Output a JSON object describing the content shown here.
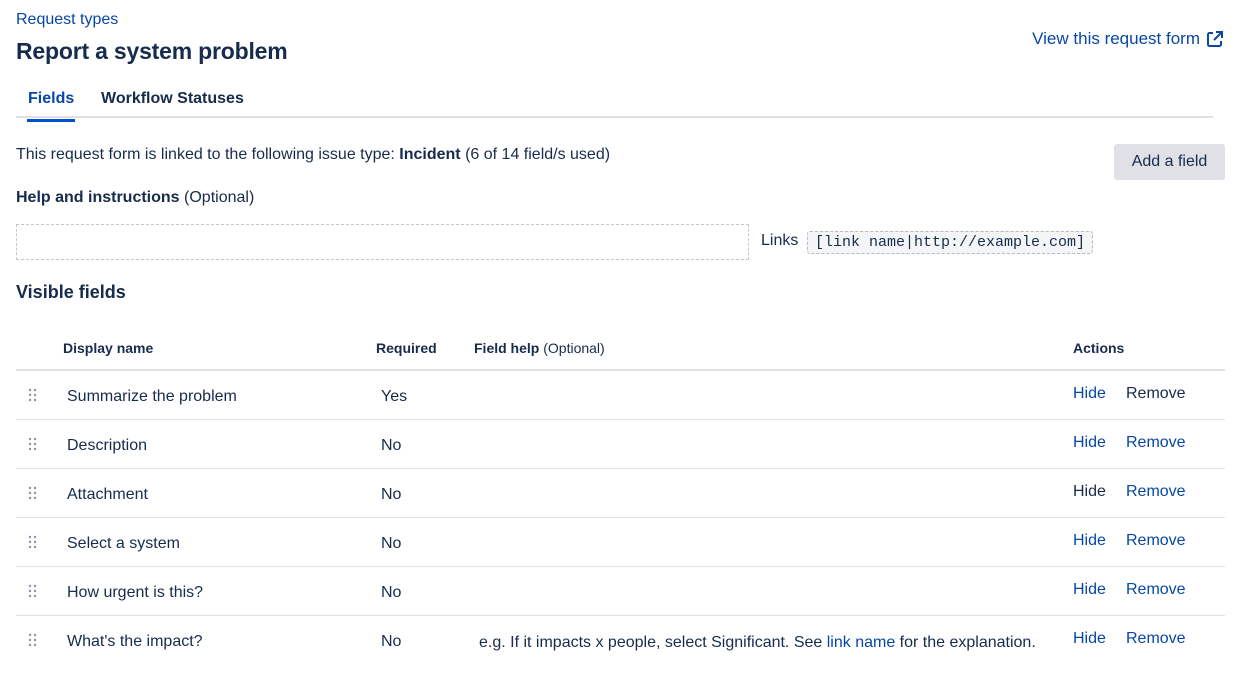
{
  "header": {
    "breadcrumb": "Request types",
    "title": "Report a system problem",
    "view_link": "View this request form"
  },
  "tabs": [
    {
      "label": "Fields",
      "active": true
    },
    {
      "label": "Workflow Statuses",
      "active": false
    }
  ],
  "linked": {
    "prefix": "This request form is linked to the following issue type: ",
    "issue_type": "Incident",
    "usage": " (6 of 14 field/s used)"
  },
  "add_field_button": "Add a field",
  "help": {
    "label": "Help and instructions",
    "optional": " (Optional)",
    "value": "",
    "links_label": "Links",
    "links_syntax": "[link name|http://example.com]"
  },
  "visible_fields_title": "Visible fields",
  "table": {
    "columns": {
      "display_name": "Display name",
      "required": "Required",
      "field_help": "Field help",
      "field_help_optional": " (Optional)",
      "actions": "Actions"
    },
    "rows": [
      {
        "name": "Summarize the problem",
        "required": "Yes",
        "help_before": "",
        "help_link": "",
        "help_after": "",
        "hide": "Hide",
        "remove": "Remove",
        "hide_enabled": true,
        "remove_enabled": false
      },
      {
        "name": "Description",
        "required": "No",
        "help_before": "",
        "help_link": "",
        "help_after": "",
        "hide": "Hide",
        "remove": "Remove",
        "hide_enabled": true,
        "remove_enabled": true
      },
      {
        "name": "Attachment",
        "required": "No",
        "help_before": "",
        "help_link": "",
        "help_after": "",
        "hide": "Hide",
        "remove": "Remove",
        "hide_enabled": false,
        "remove_enabled": true
      },
      {
        "name": "Select a system",
        "required": "No",
        "help_before": "",
        "help_link": "",
        "help_after": "",
        "hide": "Hide",
        "remove": "Remove",
        "hide_enabled": true,
        "remove_enabled": true
      },
      {
        "name": "How urgent is this?",
        "required": "No",
        "help_before": "",
        "help_link": "",
        "help_after": "",
        "hide": "Hide",
        "remove": "Remove",
        "hide_enabled": true,
        "remove_enabled": true
      },
      {
        "name": "What's the impact?",
        "required": "No",
        "help_before": "e.g. If it impacts x people, select Significant. See ",
        "help_link": "link name",
        "help_after": " for the explanation.",
        "hide": "Hide",
        "remove": "Remove",
        "hide_enabled": true,
        "remove_enabled": true
      }
    ]
  },
  "icons": {
    "external_link": "external-link-icon",
    "drag_handle": "drag-handle-icon"
  },
  "colors": {
    "link": "#0747A6",
    "text": "#172B4D",
    "button_bg": "#DFE1E6",
    "tab_underline": "#0052CC"
  }
}
